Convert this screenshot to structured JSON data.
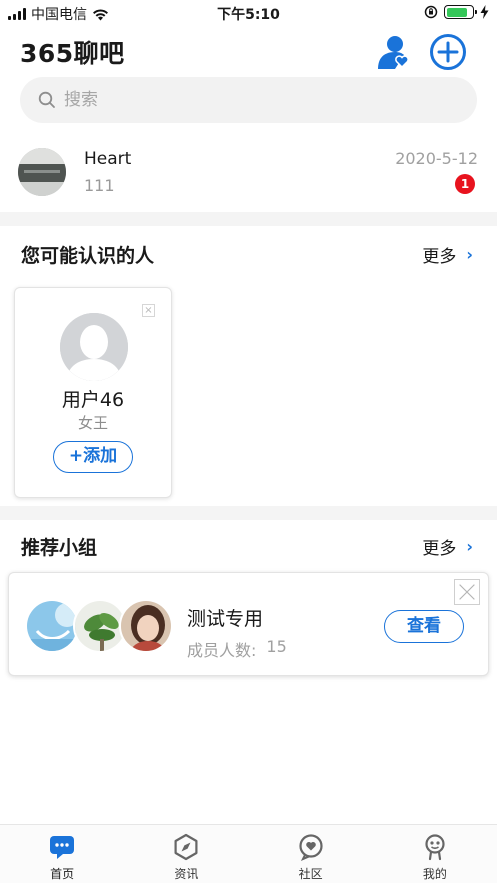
{
  "status_bar": {
    "carrier": "中国电信",
    "time": "下午5:10",
    "battery_level": 0.8
  },
  "header": {
    "title": "365聊吧",
    "contacts_icon": "person-heart-icon",
    "add_icon": "plus-circle-icon"
  },
  "search": {
    "placeholder": "搜索",
    "icon": "search-icon"
  },
  "conversation": {
    "name": "Heart",
    "last_message": "111",
    "date": "2020-5-12",
    "unread_count": "1"
  },
  "people_section": {
    "title": "您可能认识的人",
    "more_label": "更多",
    "card": {
      "close_label": "×",
      "name": "用户46",
      "subtitle": "女王",
      "add_label": "+添加"
    }
  },
  "group_section": {
    "title": "推荐小组",
    "more_label": "更多",
    "card": {
      "name": "测试专用",
      "count_label": "成员人数:",
      "count_value": "15",
      "view_label": "查看"
    }
  },
  "tabs": [
    {
      "label": "首页",
      "icon": "chat-bubble-icon",
      "active": true
    },
    {
      "label": "资讯",
      "icon": "compass-icon",
      "active": false
    },
    {
      "label": "社区",
      "icon": "heart-bubble-icon",
      "active": false
    },
    {
      "label": "我的",
      "icon": "profile-icon",
      "active": false
    }
  ],
  "colors": {
    "accent": "#1a73d9",
    "badge": "#e8131e",
    "battery": "#34c759"
  }
}
